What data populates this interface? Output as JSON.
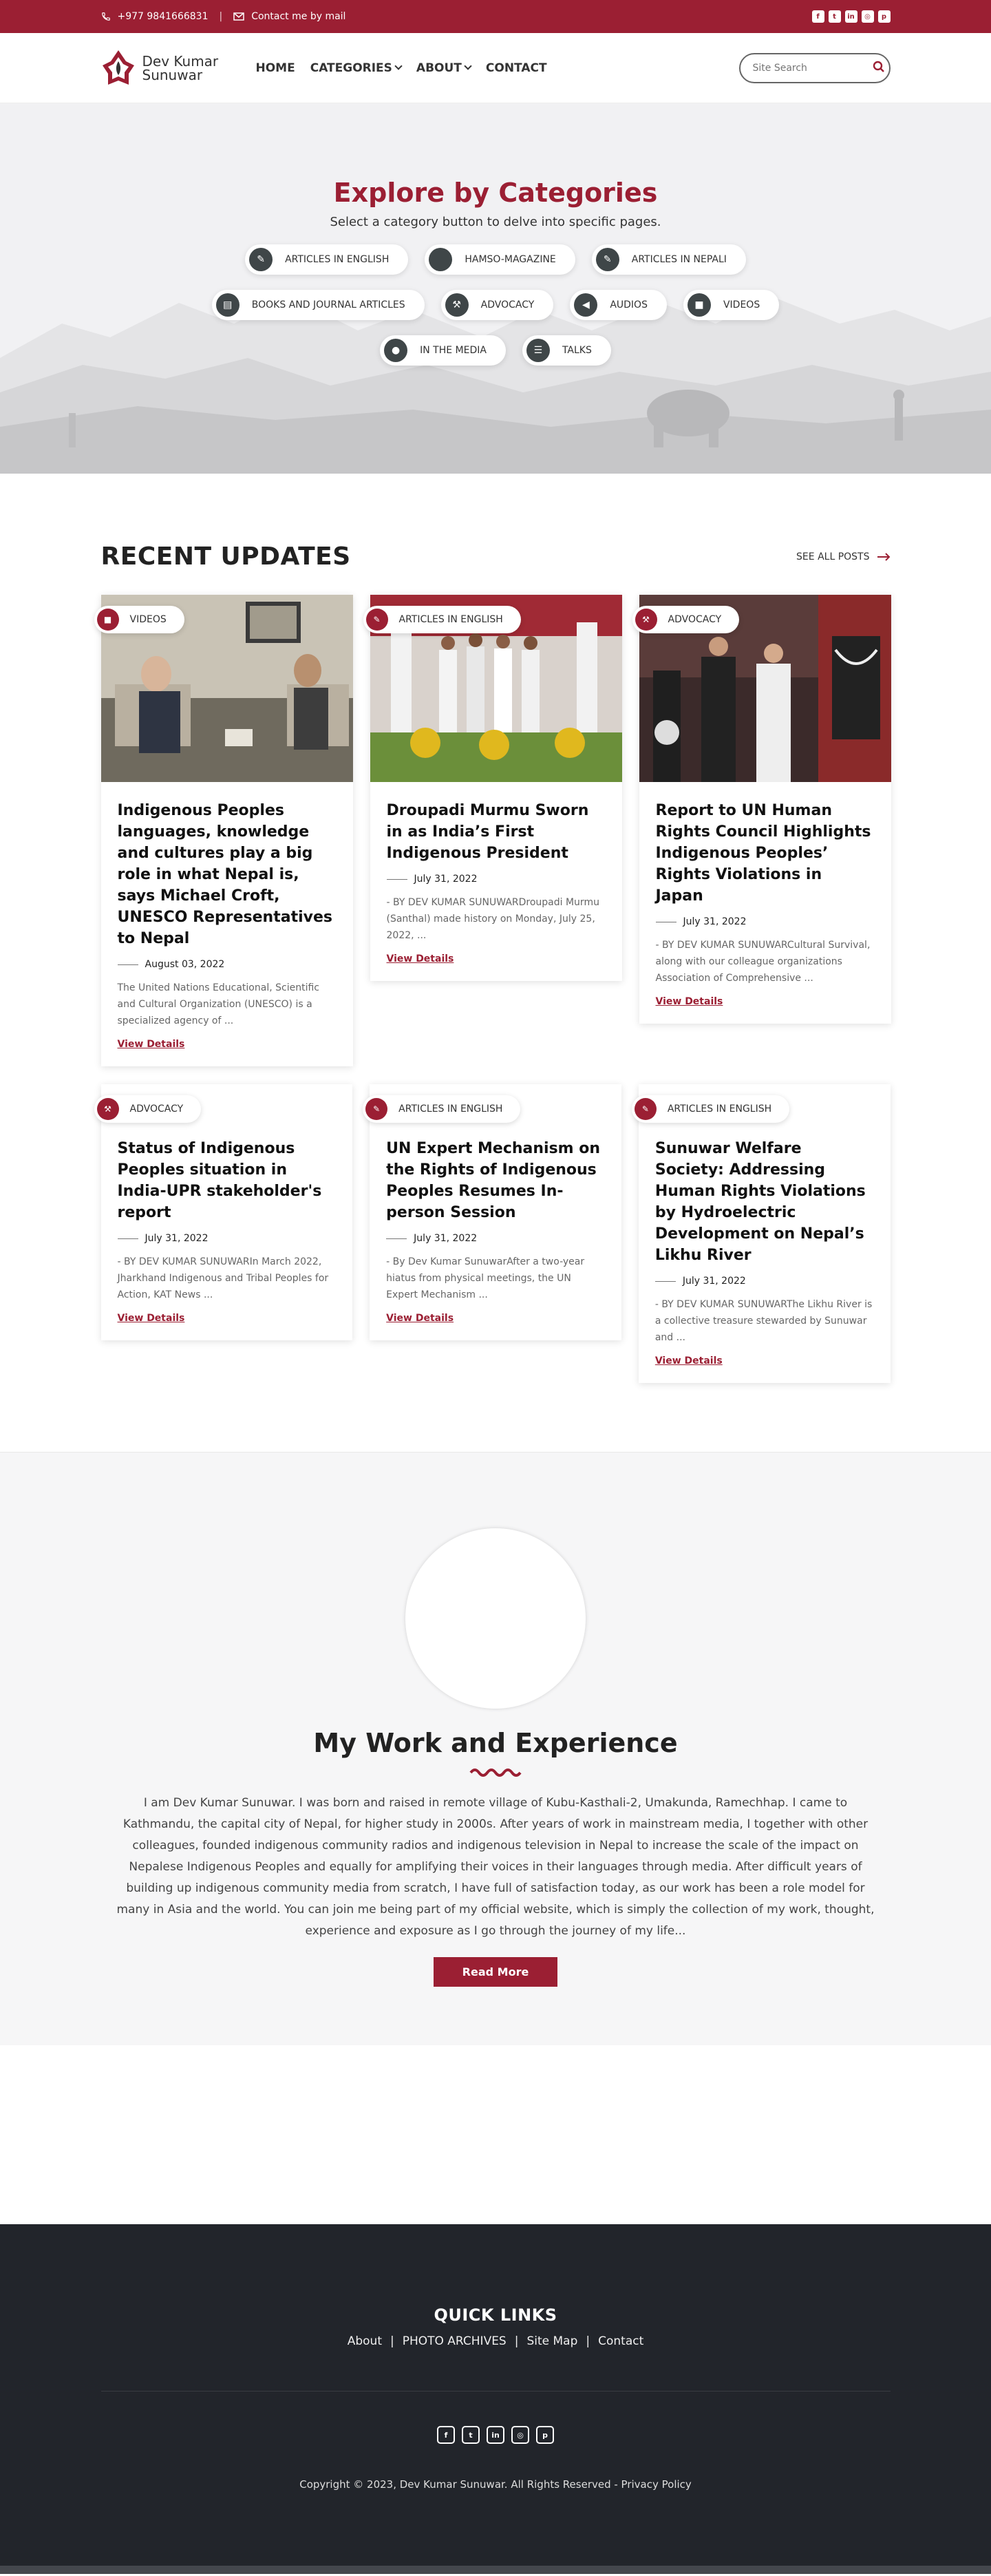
{
  "topbar": {
    "phone": "+977 9841666831",
    "email_label": "Contact me by mail",
    "social_icons": [
      "facebook-icon",
      "twitter-icon",
      "linkedin-icon",
      "instagram-icon",
      "pinterest-icon"
    ]
  },
  "header": {
    "logo_line1": "Dev Kumar",
    "logo_line2": "Sunuwar",
    "nav": [
      "HOME",
      "CATEGORIES",
      "ABOUT",
      "CONTACT"
    ],
    "search_placeholder": "Site Search"
  },
  "categories": {
    "title": "Explore by Categories",
    "subtitle": "Select a category button to delve into specific pages.",
    "rows": [
      [
        "ARTICLES IN ENGLISH",
        "HAMSO-MAGAZINE",
        "ARTICLES IN NEPALI"
      ],
      [
        "BOOKS AND JOURNAL ARTICLES",
        "ADVOCACY",
        "AUDIOS",
        "VIDEOS"
      ],
      [
        "IN THE MEDIA",
        "TALKS"
      ]
    ]
  },
  "recent": {
    "title": "RECENT UPDATES",
    "see_all": "SEE ALL POSTS",
    "view_details": "View Details",
    "cards": [
      {
        "tag": "VIDEOS",
        "title": "Indigenous Peoples languages, knowledge and cultures play a big role in what Nepal is, says Michael Croft, UNESCO Representatives to Nepal",
        "date": "August 03, 2022",
        "excerpt": "The United Nations Educational, Scientific and Cultural Organization (UNESCO) is a specialized agency of ..."
      },
      {
        "tag": "ARTICLES IN ENGLISH",
        "title": "Droupadi Murmu Sworn in as India’s First Indigenous President",
        "date": "July 31, 2022",
        "excerpt": "- BY DEV KUMAR SUNUWARDroupadi Murmu (Santhal) made history on Monday, July 25, 2022, ..."
      },
      {
        "tag": "ADVOCACY",
        "title": "Report to UN Human Rights Council Highlights Indigenous Peoples’ Rights Violations in Japan",
        "date": "July 31, 2022",
        "excerpt": "- BY DEV KUMAR SUNUWARCultural Survival, along with our colleague organizations Association of Comprehensive ..."
      },
      {
        "tag": "ADVOCACY",
        "title": "Status of Indigenous Peoples situation in India-UPR stakeholder's report",
        "date": "July 31, 2022",
        "excerpt": "- BY DEV KUMAR SUNUWARIn March 2022, Jharkhand Indigenous and Tribal Peoples for Action, KAT News ..."
      },
      {
        "tag": "ARTICLES IN ENGLISH",
        "title": "UN Expert Mechanism on the Rights of Indigenous Peoples Resumes In-person Session",
        "date": "July 31, 2022",
        "excerpt": "- By Dev Kumar SunuwarAfter a two-year hiatus from physical meetings, the UN Expert Mechanism ..."
      },
      {
        "tag": "ARTICLES IN ENGLISH",
        "title": "Sunuwar Welfare Society: Addressing Human Rights Violations by Hydroelectric Development on Nepal’s Likhu River",
        "date": "July 31, 2022",
        "excerpt": "- BY DEV KUMAR SUNUWARThe Likhu River is a collective treasure stewarded by Sunuwar and ..."
      }
    ]
  },
  "about": {
    "title": "My Work and Experience",
    "text": "I am Dev Kumar Sunuwar. I was born and raised in remote village of Kubu-Kasthali-2, Umakunda, Ramechhap. I came to Kathmandu, the capital city of Nepal, for higher study in 2000s. After years of work in mainstream media, I together with other colleagues, founded indigenous community radios and indigenous television in Nepal to increase the scale of the impact on Nepalese Indigenous Peoples and equally for amplifying their voices in their languages through media. After difficult years of building up indigenous community media from scratch, I have full of satisfaction today, as our work has been a role model for many in Asia and the world. You can join me being part of my official website, which is simply the collection of my work, thought, experience and exposure as I go through the journey of my life...",
    "button": "Read More"
  },
  "footer": {
    "title": "QUICK LINKS",
    "links": [
      "About",
      "PHOTO ARCHIVES",
      "Site Map",
      "Contact"
    ],
    "copyright": "Copyright © 2023, Dev Kumar Sunuwar. All Rights Reserved - Privacy Policy"
  },
  "colors": {
    "brand": "#9b1f33",
    "footer_bg": "#22252b",
    "icon_dark": "#3f4648"
  }
}
